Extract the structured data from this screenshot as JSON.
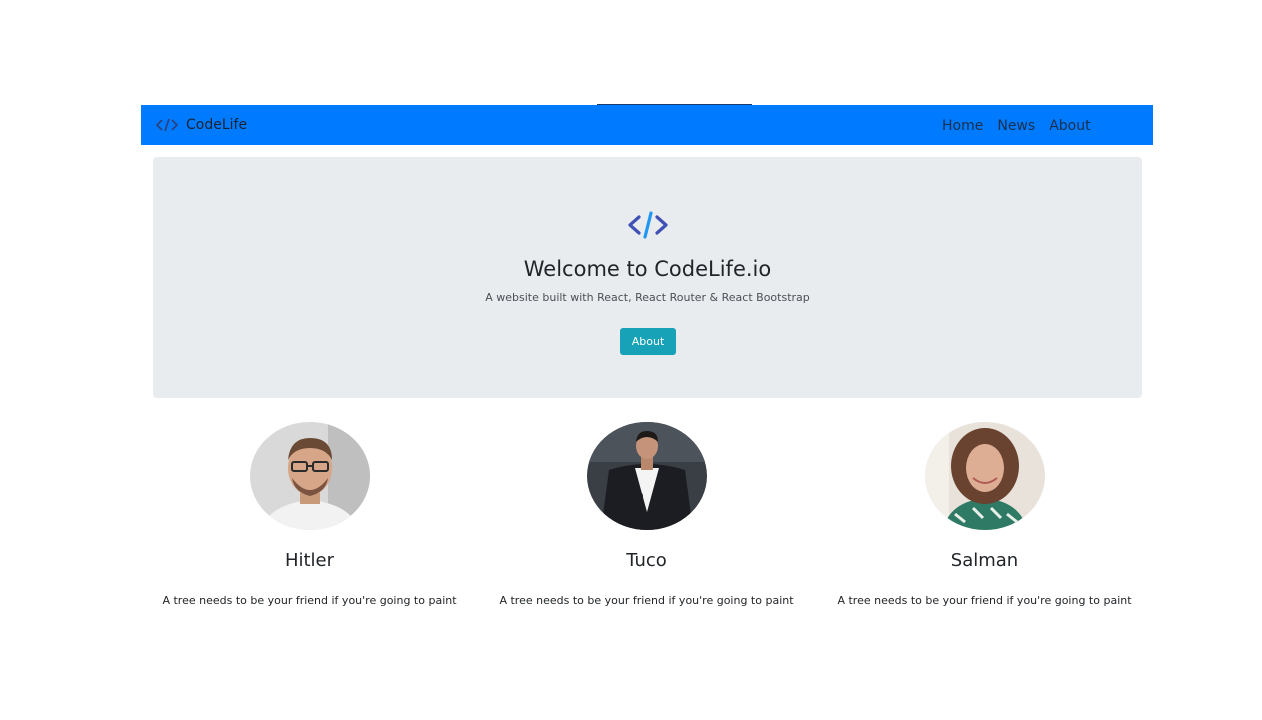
{
  "navbar": {
    "brand_icon": "code-icon",
    "brand_text": "CodeLife",
    "links": [
      "Home",
      "News",
      "About"
    ],
    "background": "#007bff"
  },
  "jumbotron": {
    "icon": "code-icon",
    "title": "Welcome to CodeLife.io",
    "subtitle": "A website built with React, React Router & React Bootstrap",
    "button_label": "About",
    "button_color": "#17a2b8"
  },
  "cards": [
    {
      "name": "Hitler",
      "text": "A tree needs to be your friend if you're going to paint",
      "image": "man-with-glasses-portrait"
    },
    {
      "name": "Tuco",
      "text": "A tree needs to be your friend if you're going to paint",
      "image": "man-in-suit-portrait"
    },
    {
      "name": "Salman",
      "text": "A tree needs to be your friend if you're going to paint",
      "image": "woman-curly-hair-portrait"
    }
  ]
}
